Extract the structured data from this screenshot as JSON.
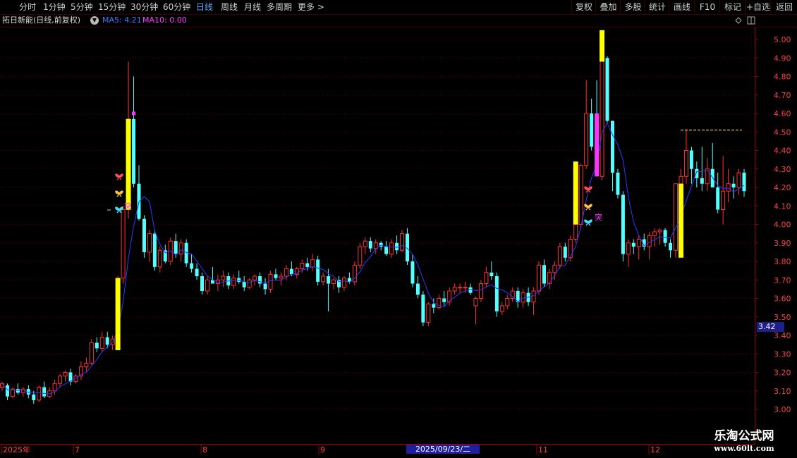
{
  "toolbar": {
    "periods": [
      "分时",
      "1分钟",
      "5分钟",
      "15分钟",
      "30分钟",
      "60分钟",
      "日线",
      "周线",
      "月线",
      "多周期",
      "更多 >"
    ],
    "active_period": "日线",
    "right_buttons": [
      "复权",
      "叠加",
      "多股",
      "统计",
      "画线",
      "F10",
      "+自选",
      "返回"
    ],
    "mark_label": "标记"
  },
  "stock": {
    "title": "拓日新能(日线,前复权)",
    "ma5": "MA5: 4.21",
    "ma10": "MA10: 0.00"
  },
  "price_axis": {
    "labels": [
      "5.00",
      "4.90",
      "4.80",
      "4.70",
      "4.60",
      "4.50",
      "4.40",
      "4.30",
      "4.20",
      "4.10",
      "4.00",
      "3.90",
      "3.80",
      "3.70",
      "3.60",
      "3.50",
      "3.40",
      "3.30",
      "3.20",
      "3.10",
      "3.00"
    ],
    "current_price": "3.42"
  },
  "date_axis": {
    "labels": [
      "2025年",
      "7",
      "8",
      "9",
      "11",
      "12"
    ],
    "highlight": "2025/09/23/二"
  },
  "signals": {
    "tu_label": "突"
  },
  "watermark": {
    "line1": "乐淘公式网",
    "line2": "www.60lt.com"
  },
  "colors": {
    "up": "#ff3232",
    "down": "#54ffff",
    "ma_line": "#2a3cff",
    "yellow_bar": "#ffff00",
    "magenta_bar": "#ff33ff",
    "axis": "#9a0000"
  },
  "chart_data": {
    "type": "candlestick",
    "title": "拓日新能(日线,前复权)",
    "y_range": [
      3.0,
      5.05
    ],
    "grid": true,
    "candles": [
      [
        3.12,
        3.15,
        3.1,
        3.14
      ],
      [
        3.13,
        3.14,
        3.05,
        3.07
      ],
      [
        3.07,
        3.12,
        3.06,
        3.11
      ],
      [
        3.11,
        3.14,
        3.08,
        3.09
      ],
      [
        3.09,
        3.12,
        3.07,
        3.11
      ],
      [
        3.11,
        3.13,
        3.06,
        3.08
      ],
      [
        3.08,
        3.1,
        3.03,
        3.05
      ],
      [
        3.05,
        3.13,
        3.04,
        3.12
      ],
      [
        3.12,
        3.15,
        3.06,
        3.07
      ],
      [
        3.07,
        3.12,
        3.06,
        3.1
      ],
      [
        3.1,
        3.16,
        3.08,
        3.14
      ],
      [
        3.14,
        3.19,
        3.12,
        3.18
      ],
      [
        3.18,
        3.21,
        3.15,
        3.2
      ],
      [
        3.2,
        3.22,
        3.13,
        3.15
      ],
      [
        3.15,
        3.19,
        3.14,
        3.18
      ],
      [
        3.18,
        3.26,
        3.16,
        3.23
      ],
      [
        3.23,
        3.28,
        3.2,
        3.25
      ],
      [
        3.25,
        3.38,
        3.24,
        3.36
      ],
      [
        3.36,
        3.39,
        3.31,
        3.33
      ],
      [
        3.33,
        3.42,
        3.31,
        3.39
      ],
      [
        3.39,
        3.42,
        3.33,
        3.35
      ],
      [
        3.35,
        3.4,
        3.32,
        3.38
      ],
      [
        3.38,
        3.72,
        3.34,
        3.71
      ],
      [
        3.71,
        4.1,
        3.68,
        4.08
      ],
      [
        4.08,
        4.88,
        4.03,
        4.57
      ],
      [
        4.57,
        4.8,
        4.2,
        4.22
      ],
      [
        4.22,
        4.32,
        4.02,
        4.03
      ],
      [
        4.03,
        4.05,
        3.82,
        3.85
      ],
      [
        3.85,
        3.97,
        3.8,
        3.95
      ],
      [
        3.95,
        3.97,
        3.75,
        3.77
      ],
      [
        3.77,
        3.88,
        3.74,
        3.86
      ],
      [
        3.86,
        3.89,
        3.79,
        3.8
      ],
      [
        3.8,
        3.93,
        3.78,
        3.91
      ],
      [
        3.91,
        3.95,
        3.82,
        3.84
      ],
      [
        3.84,
        3.92,
        3.8,
        3.9
      ],
      [
        3.9,
        3.92,
        3.77,
        3.79
      ],
      [
        3.79,
        3.84,
        3.74,
        3.76
      ],
      [
        3.76,
        3.79,
        3.7,
        3.72
      ],
      [
        3.72,
        3.74,
        3.62,
        3.64
      ],
      [
        3.64,
        3.72,
        3.62,
        3.7
      ],
      [
        3.7,
        3.77,
        3.68,
        3.68
      ],
      [
        3.68,
        3.73,
        3.64,
        3.7
      ],
      [
        3.7,
        3.75,
        3.66,
        3.72
      ],
      [
        3.72,
        3.74,
        3.65,
        3.67
      ],
      [
        3.67,
        3.73,
        3.65,
        3.71
      ],
      [
        3.71,
        3.75,
        3.68,
        3.69
      ],
      [
        3.69,
        3.72,
        3.64,
        3.66
      ],
      [
        3.66,
        3.71,
        3.65,
        3.7
      ],
      [
        3.7,
        3.73,
        3.67,
        3.72
      ],
      [
        3.72,
        3.74,
        3.66,
        3.68
      ],
      [
        3.68,
        3.71,
        3.62,
        3.65
      ],
      [
        3.65,
        3.75,
        3.63,
        3.73
      ],
      [
        3.73,
        3.76,
        3.7,
        3.71
      ],
      [
        3.71,
        3.74,
        3.67,
        3.72
      ],
      [
        3.72,
        3.78,
        3.7,
        3.76
      ],
      [
        3.76,
        3.8,
        3.72,
        3.73
      ],
      [
        3.73,
        3.77,
        3.71,
        3.76
      ],
      [
        3.76,
        3.81,
        3.74,
        3.79
      ],
      [
        3.79,
        3.82,
        3.75,
        3.77
      ],
      [
        3.77,
        3.84,
        3.75,
        3.81
      ],
      [
        3.81,
        3.83,
        3.67,
        3.69
      ],
      [
        3.69,
        3.74,
        3.67,
        3.72
      ],
      [
        3.72,
        3.76,
        3.53,
        3.68
      ],
      [
        3.68,
        3.71,
        3.65,
        3.7
      ],
      [
        3.7,
        3.72,
        3.63,
        3.66
      ],
      [
        3.66,
        3.72,
        3.64,
        3.71
      ],
      [
        3.71,
        3.74,
        3.68,
        3.69
      ],
      [
        3.69,
        3.8,
        3.67,
        3.78
      ],
      [
        3.78,
        3.9,
        3.76,
        3.88
      ],
      [
        3.88,
        3.93,
        3.84,
        3.91
      ],
      [
        3.91,
        3.93,
        3.85,
        3.87
      ],
      [
        3.87,
        3.92,
        3.84,
        3.9
      ],
      [
        3.9,
        3.91,
        3.86,
        3.88
      ],
      [
        3.88,
        3.91,
        3.83,
        3.84
      ],
      [
        3.84,
        3.92,
        3.82,
        3.9
      ],
      [
        3.9,
        3.94,
        3.84,
        3.86
      ],
      [
        3.86,
        3.97,
        3.85,
        3.95
      ],
      [
        3.95,
        3.98,
        3.78,
        3.8
      ],
      [
        3.8,
        3.84,
        3.66,
        3.68
      ],
      [
        3.68,
        3.72,
        3.6,
        3.62
      ],
      [
        3.62,
        3.64,
        3.45,
        3.47
      ],
      [
        3.47,
        3.58,
        3.45,
        3.57
      ],
      [
        3.57,
        3.6,
        3.52,
        3.55
      ],
      [
        3.55,
        3.62,
        3.54,
        3.6
      ],
      [
        3.6,
        3.64,
        3.56,
        3.58
      ],
      [
        3.58,
        3.66,
        3.56,
        3.64
      ],
      [
        3.64,
        3.68,
        3.62,
        3.66
      ],
      [
        3.66,
        3.68,
        3.63,
        3.66
      ],
      [
        3.66,
        3.69,
        3.63,
        3.66
      ],
      [
        3.66,
        3.68,
        3.62,
        3.63
      ],
      [
        3.56,
        3.61,
        3.46,
        3.6
      ],
      [
        3.6,
        3.7,
        3.58,
        3.68
      ],
      [
        3.68,
        3.77,
        3.66,
        3.74
      ],
      [
        3.74,
        3.8,
        3.7,
        3.72
      ],
      [
        3.72,
        3.74,
        3.5,
        3.53
      ],
      [
        3.53,
        3.58,
        3.51,
        3.56
      ],
      [
        3.56,
        3.62,
        3.54,
        3.6
      ],
      [
        3.6,
        3.66,
        3.58,
        3.64
      ],
      [
        3.64,
        3.66,
        3.55,
        3.58
      ],
      [
        3.58,
        3.65,
        3.55,
        3.63
      ],
      [
        3.63,
        3.66,
        3.56,
        3.58
      ],
      [
        3.58,
        3.66,
        3.51,
        3.64
      ],
      [
        3.64,
        3.8,
        3.62,
        3.78
      ],
      [
        3.78,
        3.81,
        3.66,
        3.68
      ],
      [
        3.68,
        3.76,
        3.65,
        3.74
      ],
      [
        3.74,
        3.8,
        3.7,
        3.78
      ],
      [
        3.78,
        3.9,
        3.76,
        3.88
      ],
      [
        3.88,
        3.9,
        3.8,
        3.82
      ],
      [
        3.82,
        3.94,
        3.8,
        3.92
      ],
      [
        3.92,
        4.05,
        3.9,
        4.0
      ],
      [
        4.0,
        4.33,
        3.98,
        4.32
      ],
      [
        4.32,
        4.78,
        4.3,
        4.6
      ],
      [
        4.6,
        4.68,
        4.4,
        4.42
      ],
      [
        4.42,
        4.78,
        4.26,
        4.26
      ],
      [
        4.26,
        5.05,
        4.24,
        4.9
      ],
      [
        4.9,
        4.91,
        4.55,
        4.56
      ],
      [
        4.56,
        4.42,
        4.18,
        4.28
      ],
      [
        4.28,
        4.3,
        4.14,
        4.16
      ],
      [
        4.16,
        4.18,
        3.8,
        3.84
      ],
      [
        3.84,
        3.92,
        3.77,
        3.9
      ],
      [
        3.9,
        3.92,
        3.84,
        3.88
      ],
      [
        3.88,
        3.94,
        3.81,
        3.92
      ],
      [
        3.92,
        3.95,
        3.86,
        3.88
      ],
      [
        3.88,
        3.96,
        3.81,
        3.94
      ],
      [
        3.94,
        3.98,
        3.88,
        3.96
      ],
      [
        3.96,
        3.98,
        3.89,
        3.97
      ],
      [
        3.97,
        3.98,
        3.88,
        3.9
      ],
      [
        3.9,
        3.92,
        3.82,
        3.86
      ],
      [
        3.86,
        4.22,
        3.82,
        4.22
      ],
      [
        4.22,
        4.3,
        4.1,
        4.26
      ],
      [
        4.26,
        4.51,
        4.22,
        4.4
      ],
      [
        4.4,
        4.42,
        4.22,
        4.3
      ],
      [
        4.3,
        4.34,
        4.2,
        4.25
      ],
      [
        4.25,
        4.42,
        4.18,
        4.22
      ],
      [
        4.22,
        4.36,
        4.18,
        4.3
      ],
      [
        4.3,
        4.44,
        4.2,
        4.2
      ],
      [
        4.2,
        4.28,
        4.06,
        4.08
      ],
      [
        4.08,
        4.37,
        4.0,
        4.18
      ],
      [
        4.18,
        4.3,
        4.12,
        4.22
      ],
      [
        4.22,
        4.26,
        4.14,
        4.2
      ],
      [
        4.2,
        4.3,
        4.16,
        4.28
      ],
      [
        4.28,
        4.3,
        4.15,
        4.18
      ]
    ],
    "yellow_markers": [
      [
        3.32,
        3.71
      ],
      [
        4.08,
        4.57
      ],
      [
        3.82,
        4.22
      ],
      [
        4.0,
        4.34
      ],
      [
        4.88,
        5.05
      ]
    ],
    "magenta_markers": [
      [
        4.26,
        4.6
      ]
    ],
    "resistance_line": 4.51
  }
}
